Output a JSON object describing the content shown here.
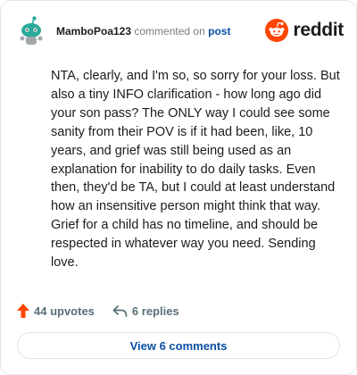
{
  "comment": {
    "author": "MamboPoa123",
    "action_text": "commented on",
    "post_link": "post",
    "body": "NTA, clearly, and I'm so, so sorry for your loss. But also a tiny INFO clarification - how long ago did your son pass? The ONLY way I could see some sanity from their POV is if it had been, like, 10 years, and grief was still being used as an explanation for inability to do daily tasks. Even then, they'd be TA, but I could at least understand how an insensitive person might think that way. Grief for a child has no timeline, and should be respected in whatever way you need. Sending love."
  },
  "brand": {
    "name": "reddit",
    "logo_icon": "reddit-snoo-icon",
    "color": "#ff4500"
  },
  "avatar": {
    "icon": "snoo-avatar-icon",
    "color": "#2aaa9b"
  },
  "actions": {
    "upvotes": "44 upvotes",
    "upvote_icon": "upvote-arrow-icon",
    "upvote_color": "#ff4500",
    "replies": "6 replies",
    "reply_icon": "reply-arrow-icon"
  },
  "view_button": {
    "label": "View 6 comments"
  }
}
